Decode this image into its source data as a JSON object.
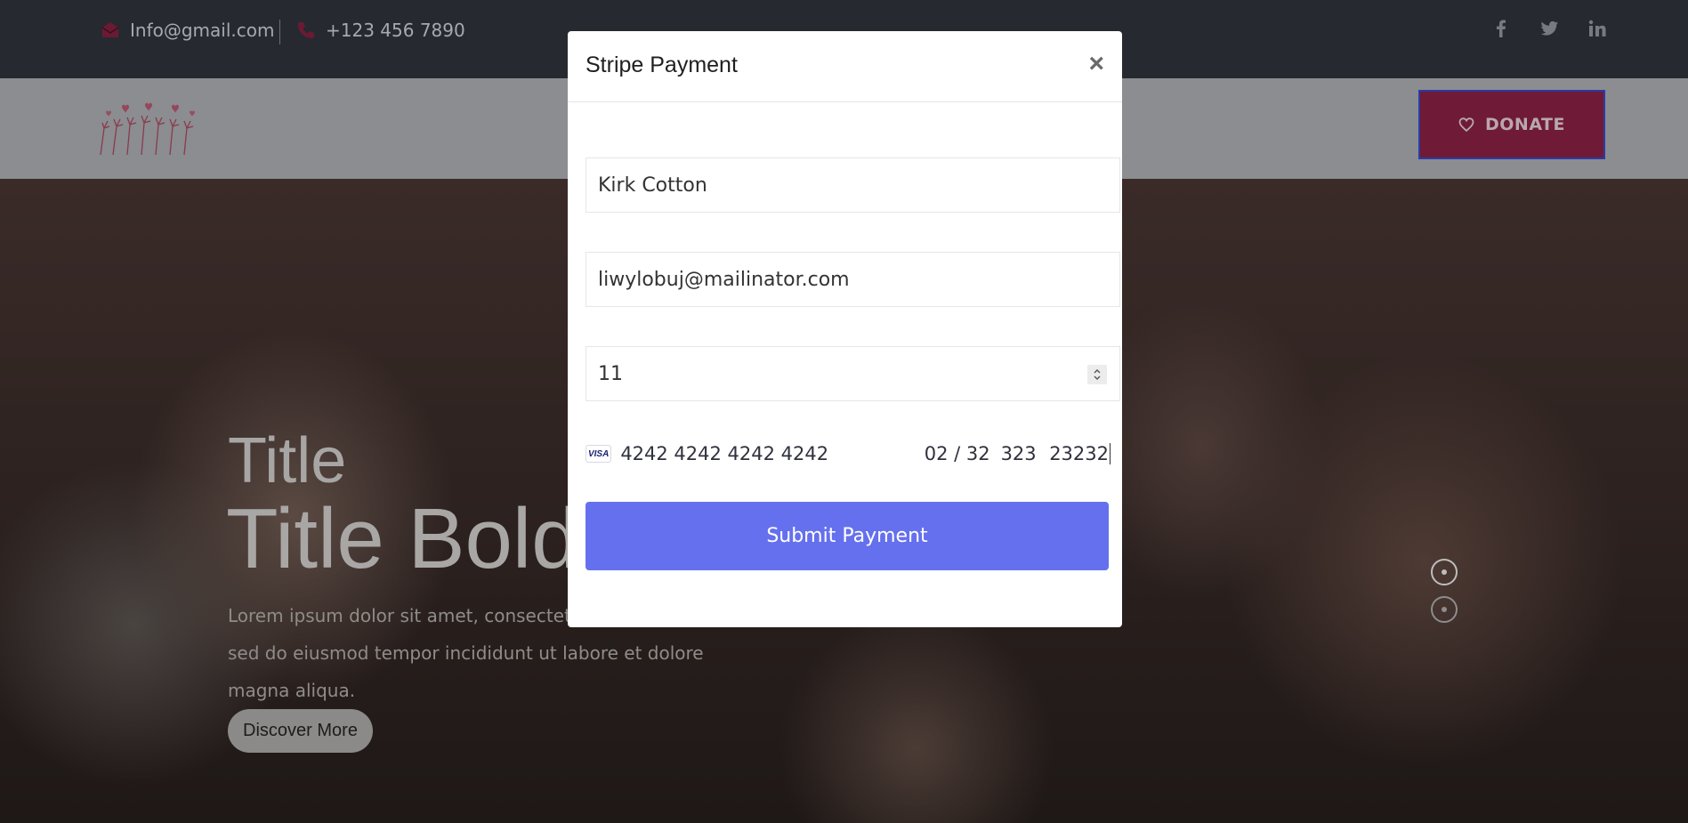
{
  "topbar": {
    "email": "Info@gmail.com",
    "phone": "+123 456 7890",
    "social_icons": [
      "facebook-icon",
      "twitter-icon",
      "linkedin-icon"
    ]
  },
  "header": {
    "donate_label": "DONATE"
  },
  "hero": {
    "subtitle": "Title",
    "title": "Title Bold",
    "text": "Lorem ipsum dolor sit amet, consectetur adipiscing elit, sed do eiusmod tempor incididunt ut labore et dolore magna aliqua.",
    "button_label": "Discover More",
    "slider_dots": 2,
    "active_dot": 1
  },
  "modal": {
    "title": "Stripe Payment",
    "close_label": "×",
    "name_value": "Kirk Cotton",
    "email_value": "liwylobuj@mailinator.com",
    "amount_value": "11",
    "card": {
      "brand": "VISA",
      "number": "4242 4242 4242 4242",
      "expiry": "02 / 32",
      "cvc": "323",
      "zip": "23232"
    },
    "submit_label": "Submit Payment"
  },
  "colors": {
    "topbar_bg": "#262a30",
    "accent_red": "#c0284f",
    "submit_bg": "#6570ee"
  }
}
